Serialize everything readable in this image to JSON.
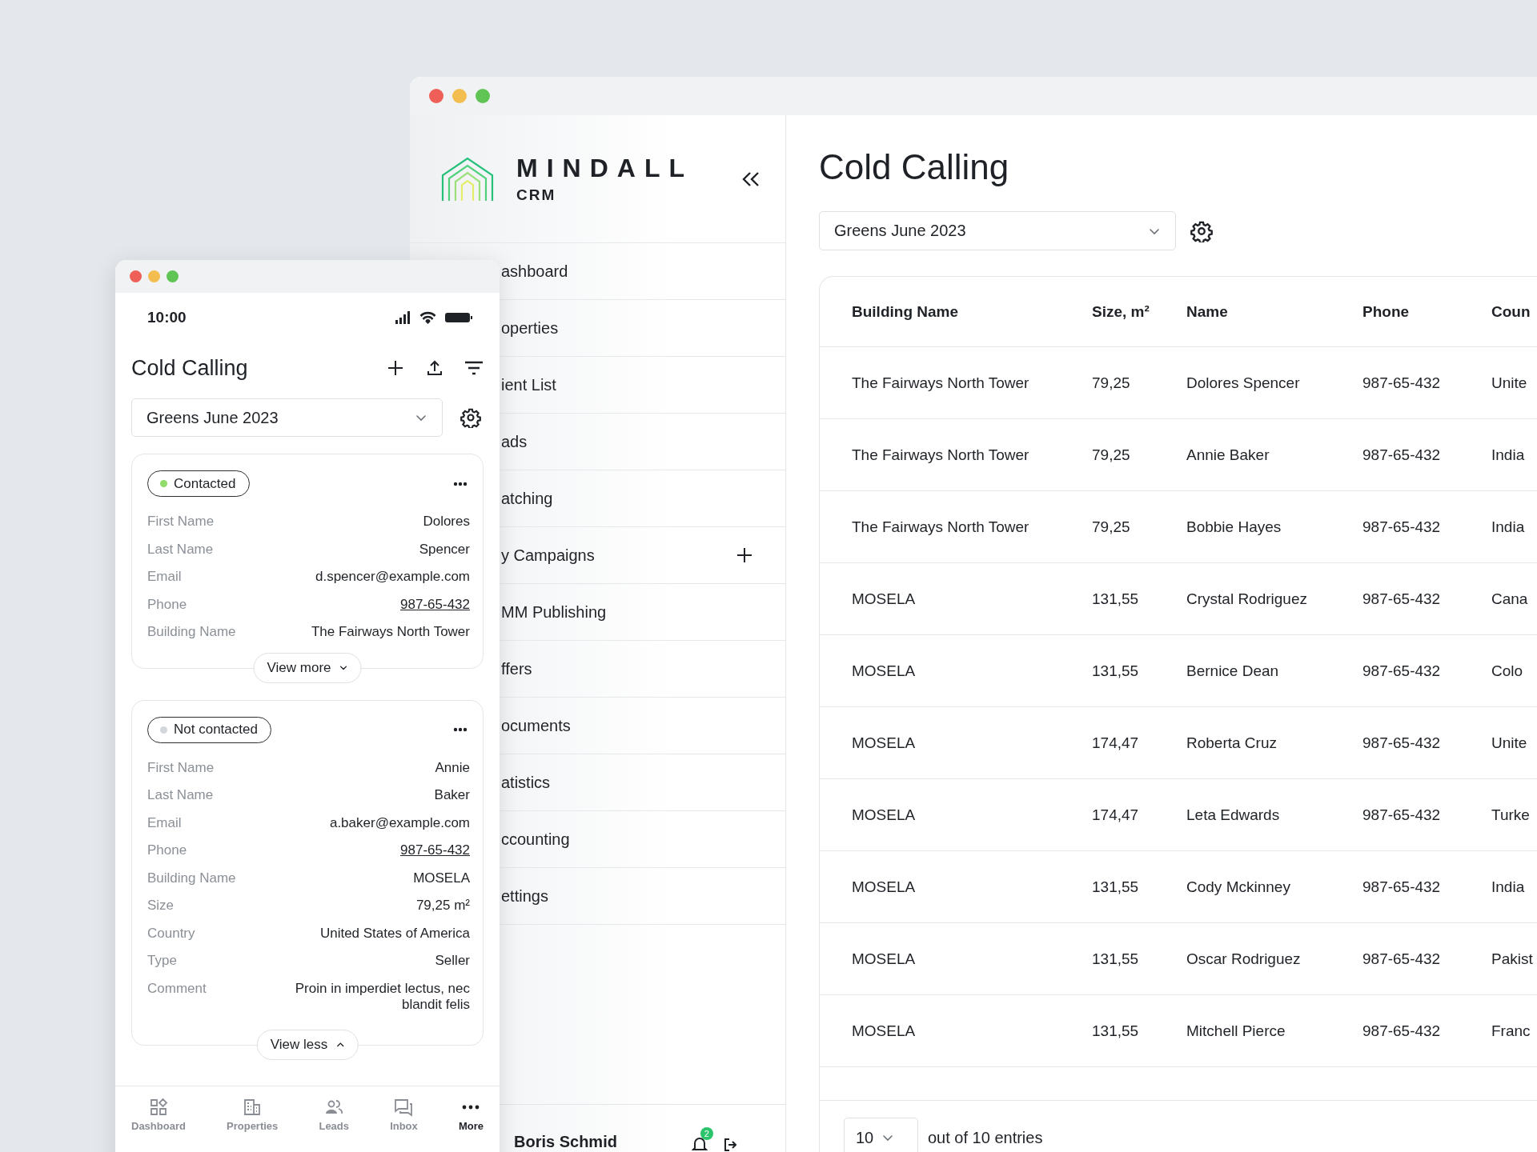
{
  "desktop": {
    "sidebar": {
      "brand": {
        "name": "MINDALL",
        "tagline": "CRM"
      },
      "items": [
        {
          "label": "ashboard",
          "addable": false
        },
        {
          "label": "operties",
          "addable": false
        },
        {
          "label": "ient List",
          "addable": false
        },
        {
          "label": "ads",
          "addable": false
        },
        {
          "label": "atching",
          "addable": false
        },
        {
          "label": "y Campaigns",
          "addable": true
        },
        {
          "label": "MM Publishing",
          "addable": false
        },
        {
          "label": "ffers",
          "addable": false
        },
        {
          "label": "ocuments",
          "addable": false
        },
        {
          "label": "atistics",
          "addable": false
        },
        {
          "label": "ccounting",
          "addable": false
        },
        {
          "label": "ettings",
          "addable": false
        }
      ],
      "user": {
        "name": "Boris Schmid",
        "badge": "2"
      }
    },
    "main": {
      "title": "Cold Calling",
      "campaign": "Greens June 2023",
      "table": {
        "columns": [
          "Building Name",
          "Size, m²",
          "Name",
          "Phone",
          "Coun"
        ],
        "rows": [
          [
            "The Fairways North Tower",
            "79,25",
            "Dolores Spencer",
            "987-65-432",
            "Unite"
          ],
          [
            "The Fairways North Tower",
            "79,25",
            "Annie Baker",
            "987-65-432",
            "India"
          ],
          [
            "The Fairways North Tower",
            "79,25",
            "Bobbie Hayes",
            "987-65-432",
            "India"
          ],
          [
            "MOSELA",
            "131,55",
            "Crystal Rodriguez",
            "987-65-432",
            "Cana"
          ],
          [
            "MOSELA",
            "131,55",
            "Bernice Dean",
            "987-65-432",
            "Colo"
          ],
          [
            "MOSELA",
            "174,47",
            "Roberta Cruz",
            "987-65-432",
            "Unite"
          ],
          [
            "MOSELA",
            "174,47",
            "Leta Edwards",
            "987-65-432",
            "Turke"
          ],
          [
            "MOSELA",
            "131,55",
            "Cody Mckinney",
            "987-65-432",
            "India"
          ],
          [
            "MOSELA",
            "131,55",
            "Oscar Rodriguez",
            "987-65-432",
            "Pakist"
          ],
          [
            "MOSELA",
            "131,55",
            "Mitchell Pierce",
            "987-65-432",
            "Franc"
          ]
        ]
      },
      "page_size": "10",
      "summary": "out of 10 entries"
    }
  },
  "mobile": {
    "time": "10:00",
    "title": "Cold Calling",
    "campaign": "Greens June 2023",
    "cards": [
      {
        "status": "Contacted",
        "color": "#8fdc6a",
        "expanded": false,
        "toggle": "View more",
        "fields": [
          {
            "label": "First Name",
            "value": "Dolores",
            "kind": "text"
          },
          {
            "label": "Last Name",
            "value": "Spencer",
            "kind": "text"
          },
          {
            "label": "Email",
            "value": "d.spencer@example.com",
            "kind": "text"
          },
          {
            "label": "Phone",
            "value": "987-65-432",
            "kind": "link"
          },
          {
            "label": "Building Name",
            "value": "The Fairways North Tower",
            "kind": "text"
          }
        ]
      },
      {
        "status": "Not contacted",
        "color": "#d3d6da",
        "expanded": true,
        "toggle": "View less",
        "fields": [
          {
            "label": "First Name",
            "value": "Annie",
            "kind": "text"
          },
          {
            "label": "Last Name",
            "value": "Baker",
            "kind": "text"
          },
          {
            "label": "Email",
            "value": "a.baker@example.com",
            "kind": "text"
          },
          {
            "label": "Phone",
            "value": "987-65-432",
            "kind": "link"
          },
          {
            "label": "Building Name",
            "value": "MOSELA",
            "kind": "text"
          },
          {
            "label": "Size",
            "value": "79,25 m²",
            "kind": "text"
          },
          {
            "label": "Country",
            "value": "United States of America",
            "kind": "text"
          },
          {
            "label": "Type",
            "value": "Seller",
            "kind": "text"
          },
          {
            "label": "Comment",
            "value": "Proin in imperdiet lectus, nec blandit felis",
            "kind": "text"
          }
        ]
      }
    ],
    "nav": [
      {
        "label": "Dashboard",
        "selected": false
      },
      {
        "label": "Properties",
        "selected": false
      },
      {
        "label": "Leads",
        "selected": false
      },
      {
        "label": "Inbox",
        "selected": false
      },
      {
        "label": "More",
        "selected": true
      }
    ]
  }
}
